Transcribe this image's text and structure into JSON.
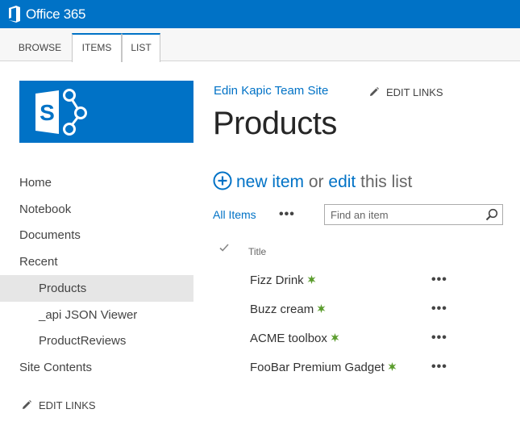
{
  "suitebar": {
    "brand": "Office 365",
    "color": "#0072c6"
  },
  "ribbon": {
    "tabs": [
      "BROWSE",
      "ITEMS",
      "LIST"
    ]
  },
  "site": {
    "title": "Edin Kapic Team Site",
    "edit_links_top": "EDIT LINKS",
    "logo_icon": "sharepoint-logo-icon"
  },
  "page": {
    "title": "Products"
  },
  "nav": {
    "items": [
      {
        "label": "Home"
      },
      {
        "label": "Notebook"
      },
      {
        "label": "Documents"
      },
      {
        "label": "Recent"
      },
      {
        "label": "Products",
        "selected": true
      },
      {
        "label": "_api JSON Viewer"
      },
      {
        "label": "ProductReviews"
      },
      {
        "label": "Site Contents"
      }
    ],
    "edit_links": "EDIT LINKS"
  },
  "list": {
    "new_item": "new item",
    "or": "or",
    "edit": "edit",
    "this_list": "this list",
    "view": "All Items",
    "more": "•••",
    "search_placeholder": "Find an item",
    "column_title": "Title",
    "rows": [
      {
        "title": "Fizz Drink",
        "is_new": true
      },
      {
        "title": "Buzz cream",
        "is_new": true
      },
      {
        "title": "ACME toolbox",
        "is_new": true
      },
      {
        "title": "FooBar Premium Gadget",
        "is_new": true
      }
    ]
  }
}
